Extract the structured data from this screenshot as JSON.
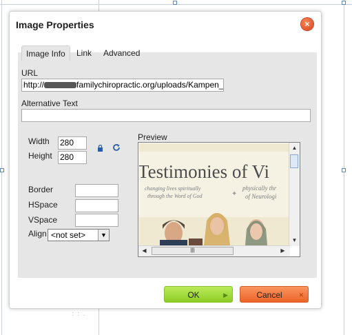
{
  "dialog": {
    "title": "Image Properties",
    "close_glyph": "×"
  },
  "tabs": [
    {
      "label": "Image Info",
      "active": true
    },
    {
      "label": "Link",
      "active": false
    },
    {
      "label": "Advanced",
      "active": false
    }
  ],
  "form": {
    "url_label": "URL",
    "url_prefix": "http://",
    "url_suffix": "familychiropractic.org/uploads/Kampen_",
    "alt_label": "Alternative Text",
    "alt_value": "",
    "width_label": "Width",
    "width_value": "280",
    "height_label": "Height",
    "height_value": "280",
    "border_label": "Border",
    "border_value": "",
    "hspace_label": "HSpace",
    "hspace_value": "",
    "vspace_label": "VSpace",
    "vspace_value": "",
    "align_label": "Align",
    "align_value": "<not set>"
  },
  "icons": {
    "lock": "lock-icon",
    "reset_size": "refresh-icon"
  },
  "preview": {
    "label": "Preview",
    "sign_title": "Testimonies of Vi",
    "sign_line_left_1": "changing lives spiritually",
    "sign_line_left_2": "through the Word of God",
    "sign_line_right_1": "physically thr",
    "sign_line_right_2": "of Neurologi"
  },
  "buttons": {
    "ok": "OK",
    "cancel": "Cancel"
  },
  "colors": {
    "ok_green": "#9ad833",
    "cancel_orange": "#f27434",
    "close_red": "#e8552a"
  }
}
